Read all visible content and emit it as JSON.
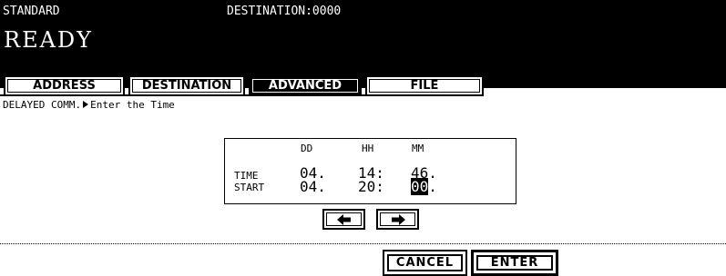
{
  "header": {
    "mode": "STANDARD",
    "destination_label": "DESTINATION:",
    "destination_value": "0000",
    "status": "READY"
  },
  "tabs": [
    {
      "label": "ADDRESS",
      "active": false
    },
    {
      "label": "DESTINATION",
      "active": false
    },
    {
      "label": "ADVANCED",
      "active": true
    },
    {
      "label": "FILE",
      "active": false
    }
  ],
  "breadcrumb": {
    "section": "DELAYED COMM.",
    "instruction": "Enter the Time"
  },
  "time_panel": {
    "columns": [
      "DD",
      "HH",
      "MM"
    ],
    "rows": [
      {
        "label": "TIME",
        "dd": "04.",
        "hh": "14:",
        "mm": "46."
      },
      {
        "label": "START",
        "dd": "04.",
        "hh": "20:",
        "mm": "00",
        "mm_suffix": "."
      }
    ]
  },
  "nav": {
    "left_icon": "left-arrow-icon",
    "right_icon": "right-arrow-icon"
  },
  "buttons": {
    "cancel": "CANCEL",
    "enter": "ENTER"
  },
  "colors": {
    "background": "#ffffff",
    "foreground": "#000000"
  }
}
